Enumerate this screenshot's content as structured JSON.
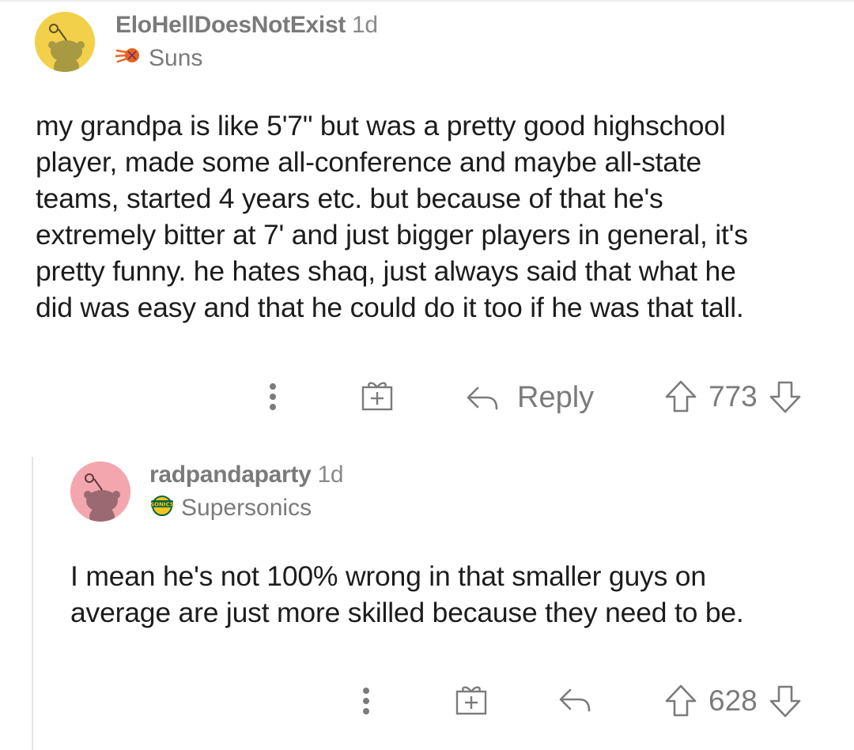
{
  "comments": [
    {
      "username": "EloHellDoesNotExist",
      "age": "1d",
      "flair": "Suns",
      "flair_icon": "suns-logo-icon",
      "avatar_color": "#f2d04a",
      "body_lines": [
        "my grandpa is like 5'7\" but was a pretty good highschool",
        "player, made some all-conference and maybe all-state",
        "teams, started 4 years etc. but because of that he's",
        "extremely bitter at 7' and just bigger players in general, it's",
        "pretty funny. he hates shaq, just always said that what he",
        "did was easy and that he could do it too if he was that tall."
      ],
      "reply_label": "Reply",
      "votes": "773"
    },
    {
      "username": "radpandaparty",
      "age": "1d",
      "flair": "Supersonics",
      "flair_icon": "sonics-logo-icon",
      "avatar_color": "#f4a6ae",
      "body_lines": [
        "I mean he's not 100% wrong in that smaller guys on",
        "average are just more skilled because they need to be."
      ],
      "votes": "628"
    }
  ],
  "colors": {
    "meta_text": "#7a7a7a",
    "body_text": "#1c1c1c",
    "thread_line": "#e4e4e4"
  }
}
